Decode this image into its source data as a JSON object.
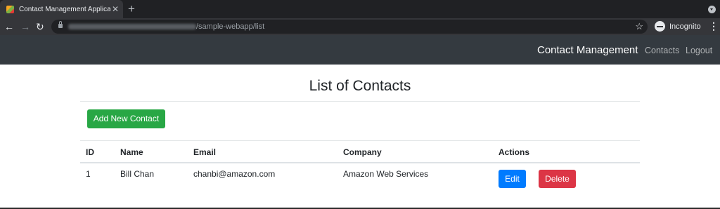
{
  "browser": {
    "tab_title": "Contact Management Applicatio",
    "tab_close": "✕",
    "new_tab": "+",
    "back": "←",
    "forward": "→",
    "reload": "↻",
    "url_path": "/sample-webapp/list",
    "bookmark": "☆",
    "profile_label": "Incognito",
    "menu": "⋮"
  },
  "navbar": {
    "brand": "Contact Management",
    "links": [
      {
        "label": "Contacts"
      },
      {
        "label": "Logout"
      }
    ]
  },
  "page": {
    "title": "List of Contacts",
    "add_button": "Add New Contact"
  },
  "table": {
    "headers": [
      "ID",
      "Name",
      "Email",
      "Company",
      "Actions"
    ],
    "rows": [
      {
        "id": "1",
        "name": "Bill Chan",
        "email": "chanbi@amazon.com",
        "company": "Amazon Web Services",
        "edit_label": "Edit",
        "delete_label": "Delete"
      }
    ]
  },
  "colors": {
    "navbar_bg": "#343a40",
    "add_button": "#28a745",
    "edit_button": "#007bff",
    "delete_button": "#dc3545"
  }
}
